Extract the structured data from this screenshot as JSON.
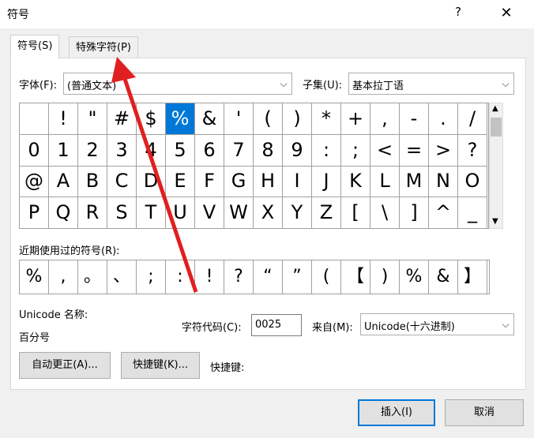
{
  "window": {
    "title": "符号",
    "help": "?",
    "close": "✕"
  },
  "tabs": [
    {
      "label": "符号(S)"
    },
    {
      "label": "特殊字符(P)"
    }
  ],
  "font": {
    "label": "字体(F):",
    "value": "(普通文本)"
  },
  "subset": {
    "label": "子集(U):",
    "value": "基本拉丁语"
  },
  "symbols": [
    " ",
    "!",
    "\"",
    "#",
    "$",
    "%",
    "&",
    "'",
    "(",
    ")",
    "*",
    "+",
    ",",
    "-",
    ".",
    "/",
    "0",
    "1",
    "2",
    "3",
    "4",
    "5",
    "6",
    "7",
    "8",
    "9",
    ":",
    ";",
    "<",
    "=",
    ">",
    "?",
    "@",
    "A",
    "B",
    "C",
    "D",
    "E",
    "F",
    "G",
    "H",
    "I",
    "J",
    "K",
    "L",
    "M",
    "N",
    "O",
    "P",
    "Q",
    "R",
    "S",
    "T",
    "U",
    "V",
    "W",
    "X",
    "Y",
    "Z",
    "[",
    "\\",
    "]",
    "^",
    "_"
  ],
  "selected_symbol": "%",
  "recent": {
    "label": "近期使用过的符号(R):",
    "symbols": [
      "%",
      ",",
      "。",
      "、",
      ";",
      ":",
      "!",
      "?",
      "“",
      "”",
      "(",
      "【",
      ")",
      "%",
      "&",
      "】"
    ]
  },
  "unicode": {
    "name_label": "Unicode 名称:",
    "name_value": "百分号"
  },
  "char_code": {
    "label": "字符代码(C):",
    "value": "0025"
  },
  "from": {
    "label": "来自(M):",
    "value": "Unicode(十六进制)"
  },
  "buttons": {
    "autocorrect": "自动更正(A)...",
    "shortcut_key": "快捷键(K)...",
    "shortcut_label": "快捷键:",
    "insert": "插入(I)",
    "cancel": "取消"
  },
  "annotation": {
    "arrow_color": "#e02020"
  }
}
